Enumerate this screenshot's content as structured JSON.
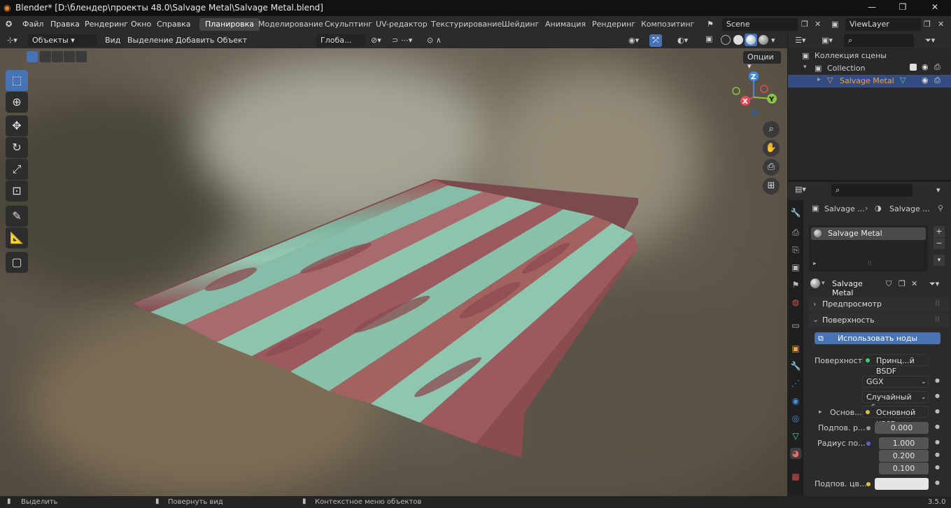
{
  "window": {
    "title": "Blender* [D:\\блендер\\проекты 48.0\\Salvage Metal\\Salvage Metal.blend]"
  },
  "menu": [
    "Файл",
    "Правка",
    "Рендеринг",
    "Окно",
    "Справка"
  ],
  "workspaces": [
    "Планировка",
    "Моделирование",
    "Скульптинг",
    "UV-редактор",
    "Текстурирование",
    "Шейдинг",
    "Анимация",
    "Рендеринг",
    "Композитинг"
  ],
  "scene": "Scene",
  "view_layer": "ViewLayer",
  "viewport_header": {
    "mode": "Объекты",
    "items": [
      "Вид",
      "Выделение",
      "Добавить",
      "Объект"
    ],
    "transform": "Глоба...",
    "options": "Опции"
  },
  "outliner": {
    "scene_collection": "Коллекция сцены",
    "collection": "Collection",
    "object": "Salvage Metal"
  },
  "properties": {
    "breadcrumb": [
      "Salvage ...",
      "Salvage ..."
    ],
    "slot": "Salvage Metal",
    "material_name": "Salvage Metal",
    "preview": "Предпросмотр",
    "surface_section": "Поверхность",
    "use_nodes": "Использовать ноды",
    "surface_label": "Поверхность",
    "surface_value": "Принц...й BSDF",
    "distribution": "GGX",
    "subsurface_method": "Случайный об...",
    "base_label": "Основ...",
    "base_value": "Основной цвет",
    "sub_label": "Подпов. р...",
    "sub_value": "0.000",
    "radius_label": "Радиус по...",
    "radius": [
      "1.000",
      "0.200",
      "0.100"
    ],
    "subcolor_label": "Подпов. цв..."
  },
  "status": {
    "left": "Выделить",
    "mid": "Повернуть вид",
    "right": "Контекстное меню объектов",
    "version": "3.5.0"
  },
  "gizmo": {
    "x": "X",
    "y": "Y",
    "z": "Z"
  },
  "colors": {
    "accent": "#4772b3",
    "x": "#e24a5a",
    "y": "#8ac24a",
    "z": "#3f8de0"
  }
}
